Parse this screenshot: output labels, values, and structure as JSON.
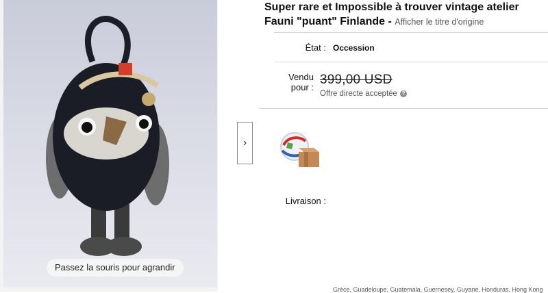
{
  "listing": {
    "title": "Super rare et Impossible à trouver vintage atelier Fauni \"puant\" Finlande",
    "title_separator": " - ",
    "view_original": "Afficher le titre d'origine"
  },
  "gallery": {
    "zoom_hint": "Passez la souris pour agrandir",
    "next_arrow": "›"
  },
  "condition": {
    "label": "État :",
    "value": "Occession"
  },
  "sold": {
    "label_line1": "Vendu",
    "label_line2": "pour :",
    "price": "399,00 USD",
    "offer_note": "Offre directe acceptée",
    "help_glyph": "?"
  },
  "shipping": {
    "icon": "global-shipping-icon",
    "label": "Livraison :",
    "countries": "Grèce, Guadeloupe, Guatemala, Guernesey, Guyane, Honduras, Hong Kong"
  }
}
